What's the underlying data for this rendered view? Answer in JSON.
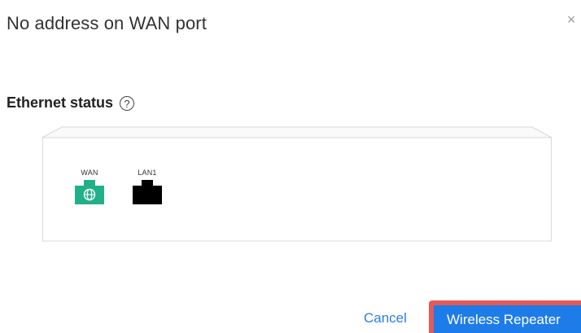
{
  "dialog": {
    "title": "No address on WAN port",
    "close_icon": "close-icon",
    "close_glyph": "×"
  },
  "ethernet": {
    "heading": "Ethernet status",
    "help_glyph": "?",
    "ports": [
      {
        "label": "WAN",
        "icon": "globe-icon",
        "color": "#21b08a",
        "status": "connected-no-address"
      },
      {
        "label": "LAN1",
        "icon": "ethernet-port-icon",
        "color": "#000000",
        "status": "inactive"
      }
    ]
  },
  "actions": {
    "cancel_label": "Cancel",
    "primary_label": "Wireless Repeater"
  },
  "colors": {
    "accent": "#1e7ce8",
    "link": "#2b7de9",
    "highlight": "#e25b5b",
    "wan_port": "#21b08a"
  }
}
